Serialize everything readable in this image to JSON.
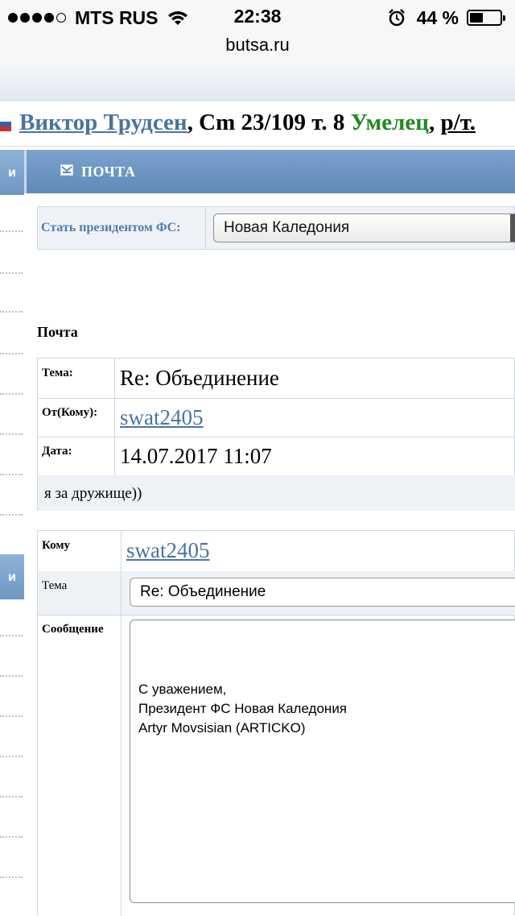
{
  "status_bar": {
    "carrier": "MTS RUS",
    "time": "22:38",
    "battery": "44 %",
    "battery_level": 0.44,
    "url": "butsa.ru",
    "icons": [
      "signal-dots-icon",
      "wifi-icon",
      "alarm-icon",
      "battery-icon"
    ]
  },
  "player": {
    "name": "Виктор Трудсен",
    "stats": ", Cm 23/109 т. 8 ",
    "skill": "Умелец",
    "sep": ", ",
    "extra": "р/т.",
    "colors": {
      "link": "#4a74a0",
      "skill": "#1f8a1f"
    }
  },
  "sidebar": {
    "tab1": "и",
    "tab2": "и"
  },
  "mail_header": {
    "title": "ПОЧТА",
    "icon": "mail-icon",
    "color": "#6b94c1"
  },
  "president": {
    "label": "Стать президентом ФС:",
    "selected": "Новая Каледония"
  },
  "section_title": "Почта",
  "message": {
    "subject_label": "Тема:",
    "subject": "Re: Объединение",
    "from_label": "От(Кому):",
    "from": "swat2405",
    "date_label": "Дата:",
    "date": "14.07.2017 11:07",
    "body": "я за дружище))"
  },
  "reply": {
    "to_label": "Кому",
    "to": "swat2405",
    "subject_label": "Тема",
    "subject_value": "Re: Объединение",
    "message_label": "Сообщение",
    "message_lines": [
      "С уважением,",
      "Президент ФС Новая Каледония",
      "Artyr Movsisian (ARTICKO)"
    ]
  }
}
